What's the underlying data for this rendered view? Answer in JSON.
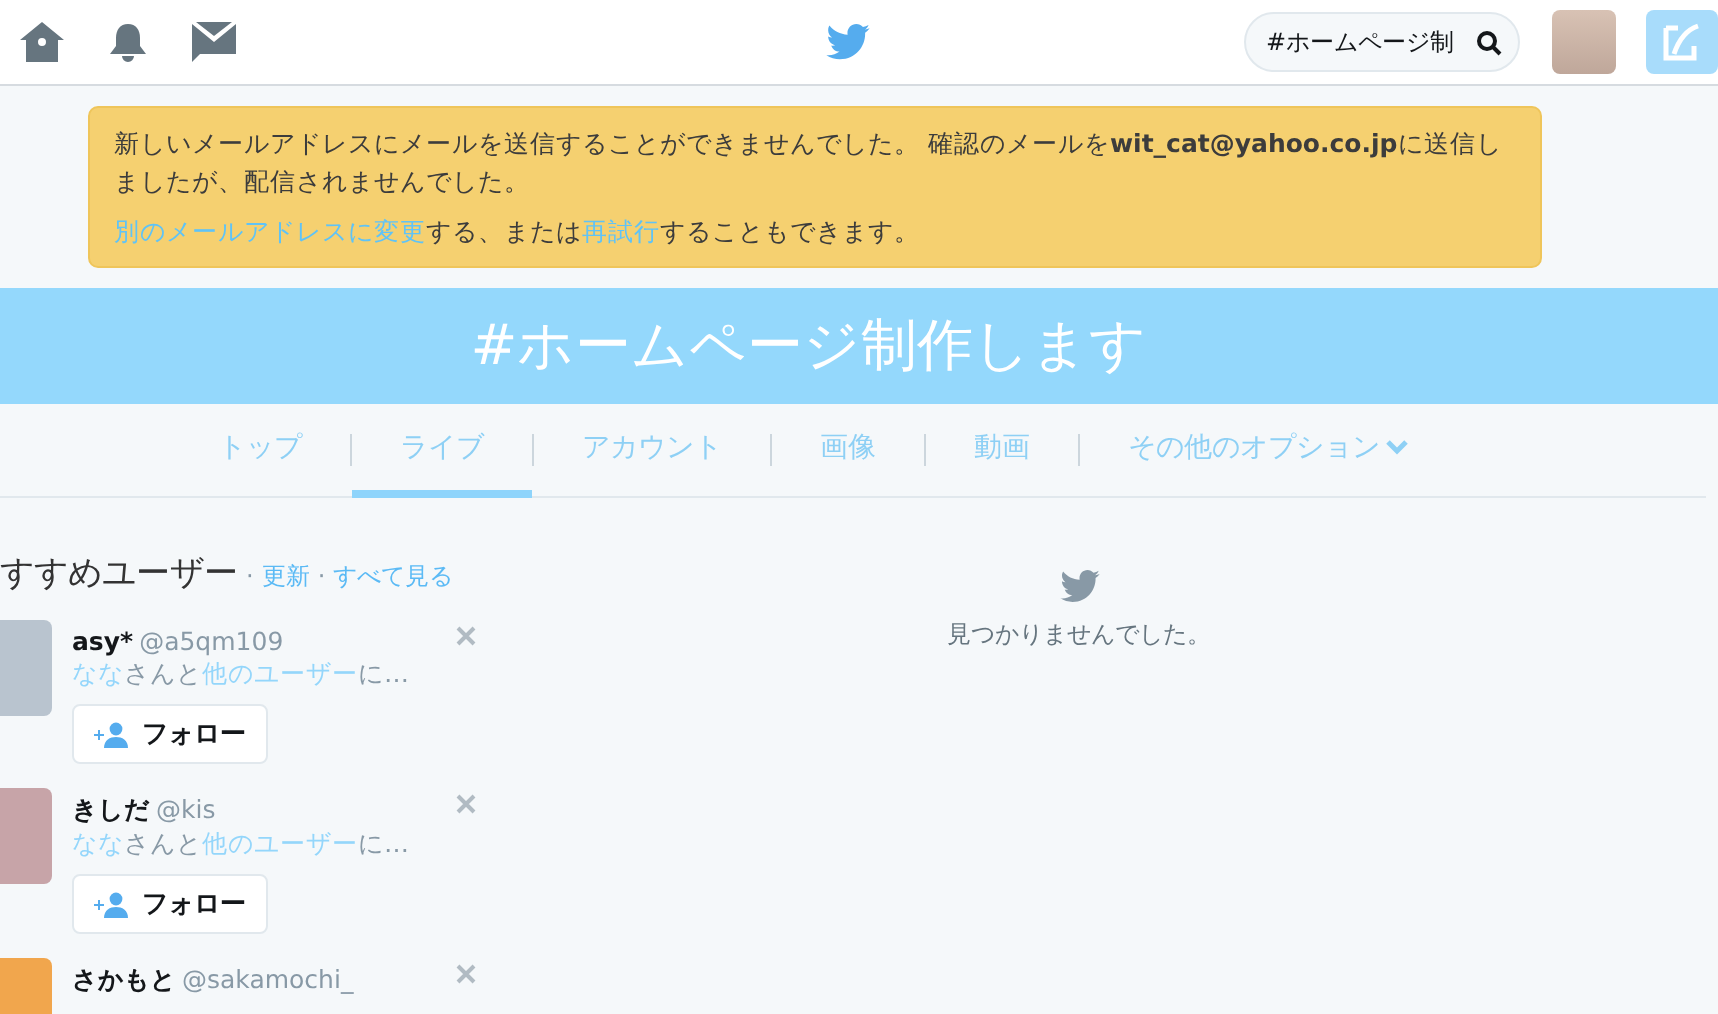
{
  "search": {
    "value": "#ホームページ制"
  },
  "alert": {
    "message": "新しいメールアドレスにメールを送信することができませんでした。 確認のメールを**wit_cat@yahoo.co.jp**に送信しましたが、配信されませんでした。",
    "actions": [
      {
        "kind": "link",
        "text": "別のメールアドレスに変更"
      },
      {
        "kind": "text",
        "text": "する、または"
      },
      {
        "kind": "link",
        "text": "再試行"
      },
      {
        "kind": "text",
        "text": "することもできます。"
      }
    ]
  },
  "banner": {
    "title": "#ホームページ制作します"
  },
  "tabs": [
    {
      "label": "トップ",
      "selected": false
    },
    {
      "label": "ライブ",
      "selected": true
    },
    {
      "label": "アカウント",
      "selected": false
    },
    {
      "label": "画像",
      "selected": false
    },
    {
      "label": "動画",
      "selected": false
    },
    {
      "label": "その他のオプション",
      "selected": false,
      "kind": "menu"
    }
  ],
  "suggestions": {
    "title": "すすめユーザー",
    "separator": "·",
    "links": [
      "更新",
      "すべて見る"
    ],
    "users": [
      {
        "name": "asy*",
        "handle": "@a5qm109",
        "context": [
          {
            "kind": "link",
            "text": "なな"
          },
          {
            "kind": "text",
            "text": "さんと"
          },
          {
            "kind": "link",
            "text": "他のユーザー"
          },
          {
            "kind": "text",
            "text": "に…"
          }
        ],
        "button": "フォロー"
      },
      {
        "name": "きしだ",
        "handle": "@kis",
        "context": [
          {
            "kind": "link",
            "text": "なな"
          },
          {
            "kind": "text",
            "text": "さんと"
          },
          {
            "kind": "link",
            "text": "他のユーザー"
          },
          {
            "kind": "text",
            "text": "に…"
          }
        ],
        "button": "フォロー"
      },
      {
        "name": "さかもと",
        "handle": "@sakamochi_"
      }
    ]
  },
  "results": {
    "empty_message": "見つかりませんでした。"
  }
}
